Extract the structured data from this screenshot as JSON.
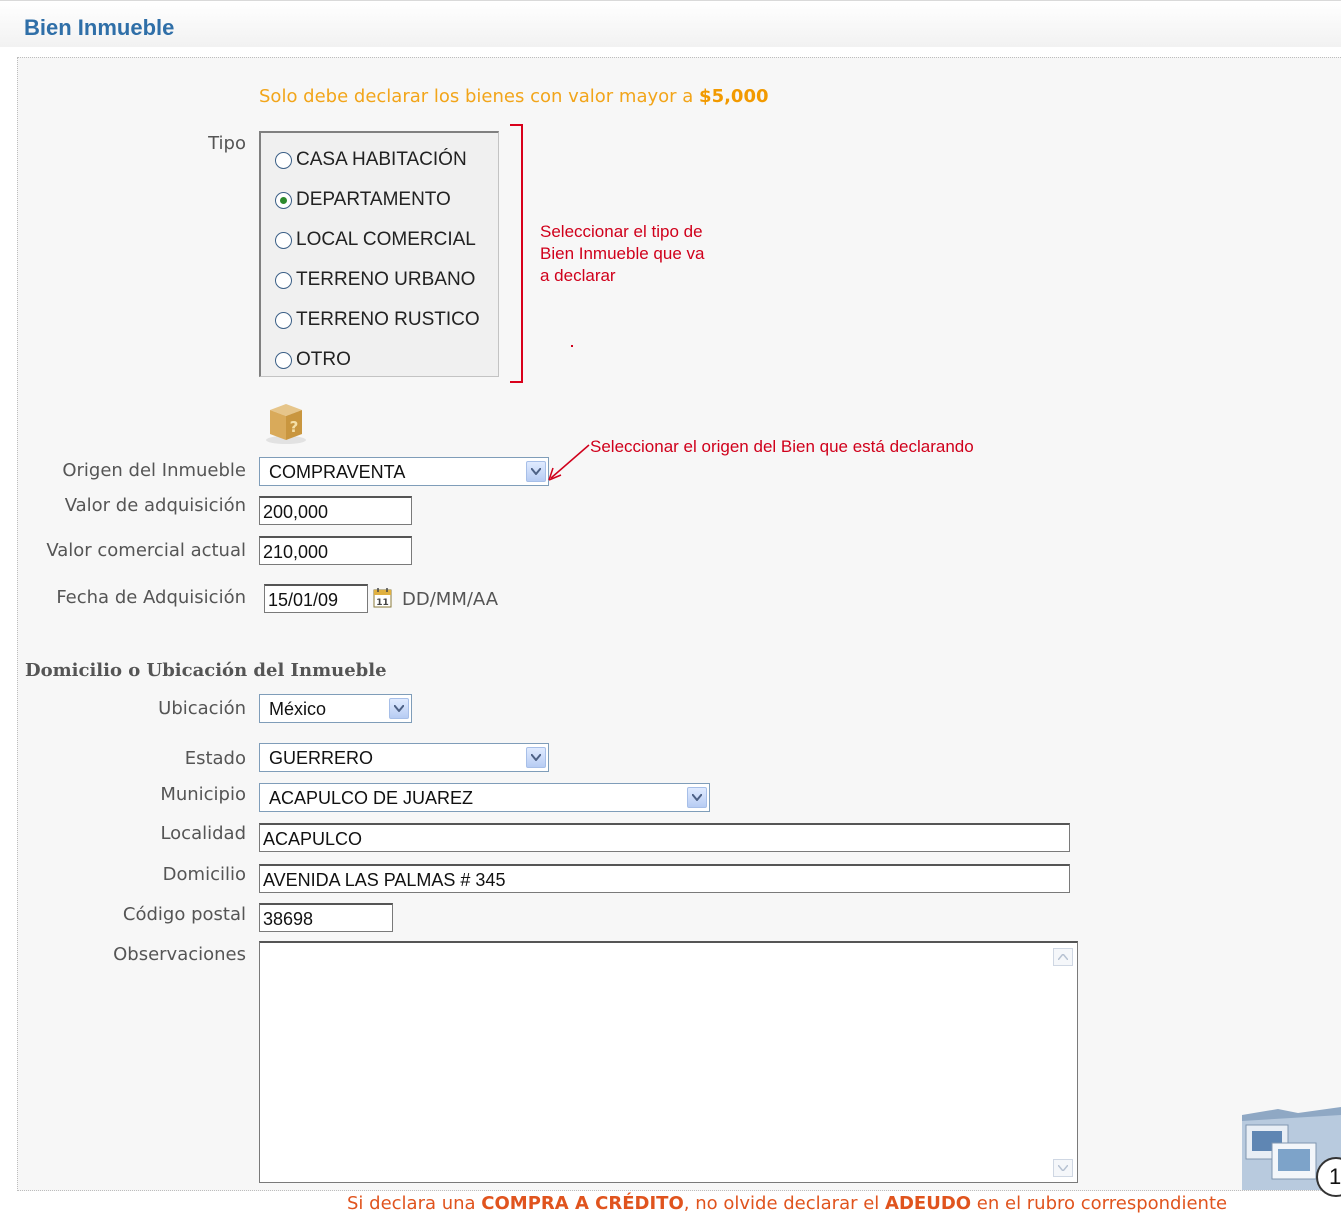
{
  "header": {
    "title": "Bien Inmueble"
  },
  "notice": {
    "text": "Solo debe declarar los bienes con valor mayor a ",
    "amount": "$5,000"
  },
  "tipo": {
    "label": "Tipo",
    "options": [
      "CASA HABITACIÓN",
      "DEPARTAMENTO",
      "LOCAL COMERCIAL",
      "TERRENO URBANO",
      "TERRENO RUSTICO",
      "OTRO"
    ],
    "selected": "DEPARTAMENTO"
  },
  "annotations": {
    "tipo_line1": "Seleccionar el tipo de",
    "tipo_line2": "Bien Inmueble que va",
    "tipo_line3": "a declarar",
    "origen": "Seleccionar el origen del Bien que está declarando"
  },
  "form": {
    "origen_label": "Origen del Inmueble",
    "origen_value": "COMPRAVENTA",
    "valor_adq_label": "Valor de adquisición",
    "valor_adq_value": "200,000",
    "valor_com_label": "Valor comercial actual",
    "valor_com_value": "210,000",
    "fecha_label": "Fecha de Adquisición",
    "fecha_value": "15/01/09",
    "fecha_format": "DD/MM/AA"
  },
  "domicilio": {
    "section_title": "Domicilio o Ubicación del Inmueble",
    "ubicacion_label": "Ubicación",
    "ubicacion_value": "México",
    "estado_label": "Estado",
    "estado_value": "GUERRERO",
    "municipio_label": "Municipio",
    "municipio_value": "ACAPULCO DE JUAREZ",
    "localidad_label": "Localidad",
    "localidad_value": "ACAPULCO",
    "domicilio_label": "Domicilio",
    "domicilio_value": "AVENIDA LAS PALMAS # 345",
    "cp_label": "Código postal",
    "cp_value": "38698",
    "observaciones_label": "Observaciones",
    "observaciones_value": ""
  },
  "footer": {
    "p1": "Si declara una ",
    "b1": "COMPRA A CRÉDITO",
    "p2": ", no olvide declarar el ",
    "b2": "ADEUDO",
    "p3": " en el rubro correspondiente"
  },
  "badge": {
    "number": "1"
  },
  "icons": {
    "help": "help-box-icon",
    "calendar": "calendar-icon",
    "folder": "documents-folder-icon"
  }
}
